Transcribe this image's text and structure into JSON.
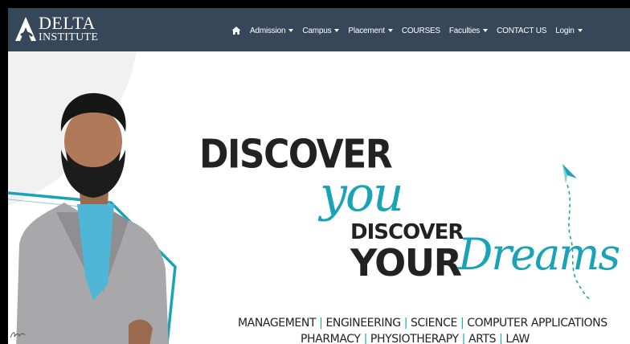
{
  "brand": {
    "line1": "DELTA",
    "line2": "INSTITUTE"
  },
  "nav": {
    "home_icon": "home-icon",
    "items": [
      {
        "label": "Admission",
        "dropdown": true
      },
      {
        "label": "Campus",
        "dropdown": true
      },
      {
        "label": "Placement",
        "dropdown": true
      },
      {
        "label": "COURSES",
        "dropdown": false
      },
      {
        "label": "Faculties",
        "dropdown": true
      },
      {
        "label": "CONTACT US",
        "dropdown": false
      },
      {
        "label": "Login",
        "dropdown": true
      }
    ]
  },
  "hero": {
    "discover_1": "DISCOVER",
    "you": "you",
    "discover_2": "DISCOVER",
    "your": "YOUR",
    "dreams": "Dreams",
    "streams_line1": [
      "MANAGEMENT",
      "ENGINEERING",
      "SCIENCE",
      "COMPUTER APPLICATIONS"
    ],
    "streams_line2": [
      "PHARMACY",
      "PHYSIOTHERAPY",
      "ARTS",
      "LAW"
    ],
    "separator": "|"
  },
  "colors": {
    "navbar": "#37475a",
    "accent": "#1aa3b6",
    "text_dark": "#222222"
  }
}
